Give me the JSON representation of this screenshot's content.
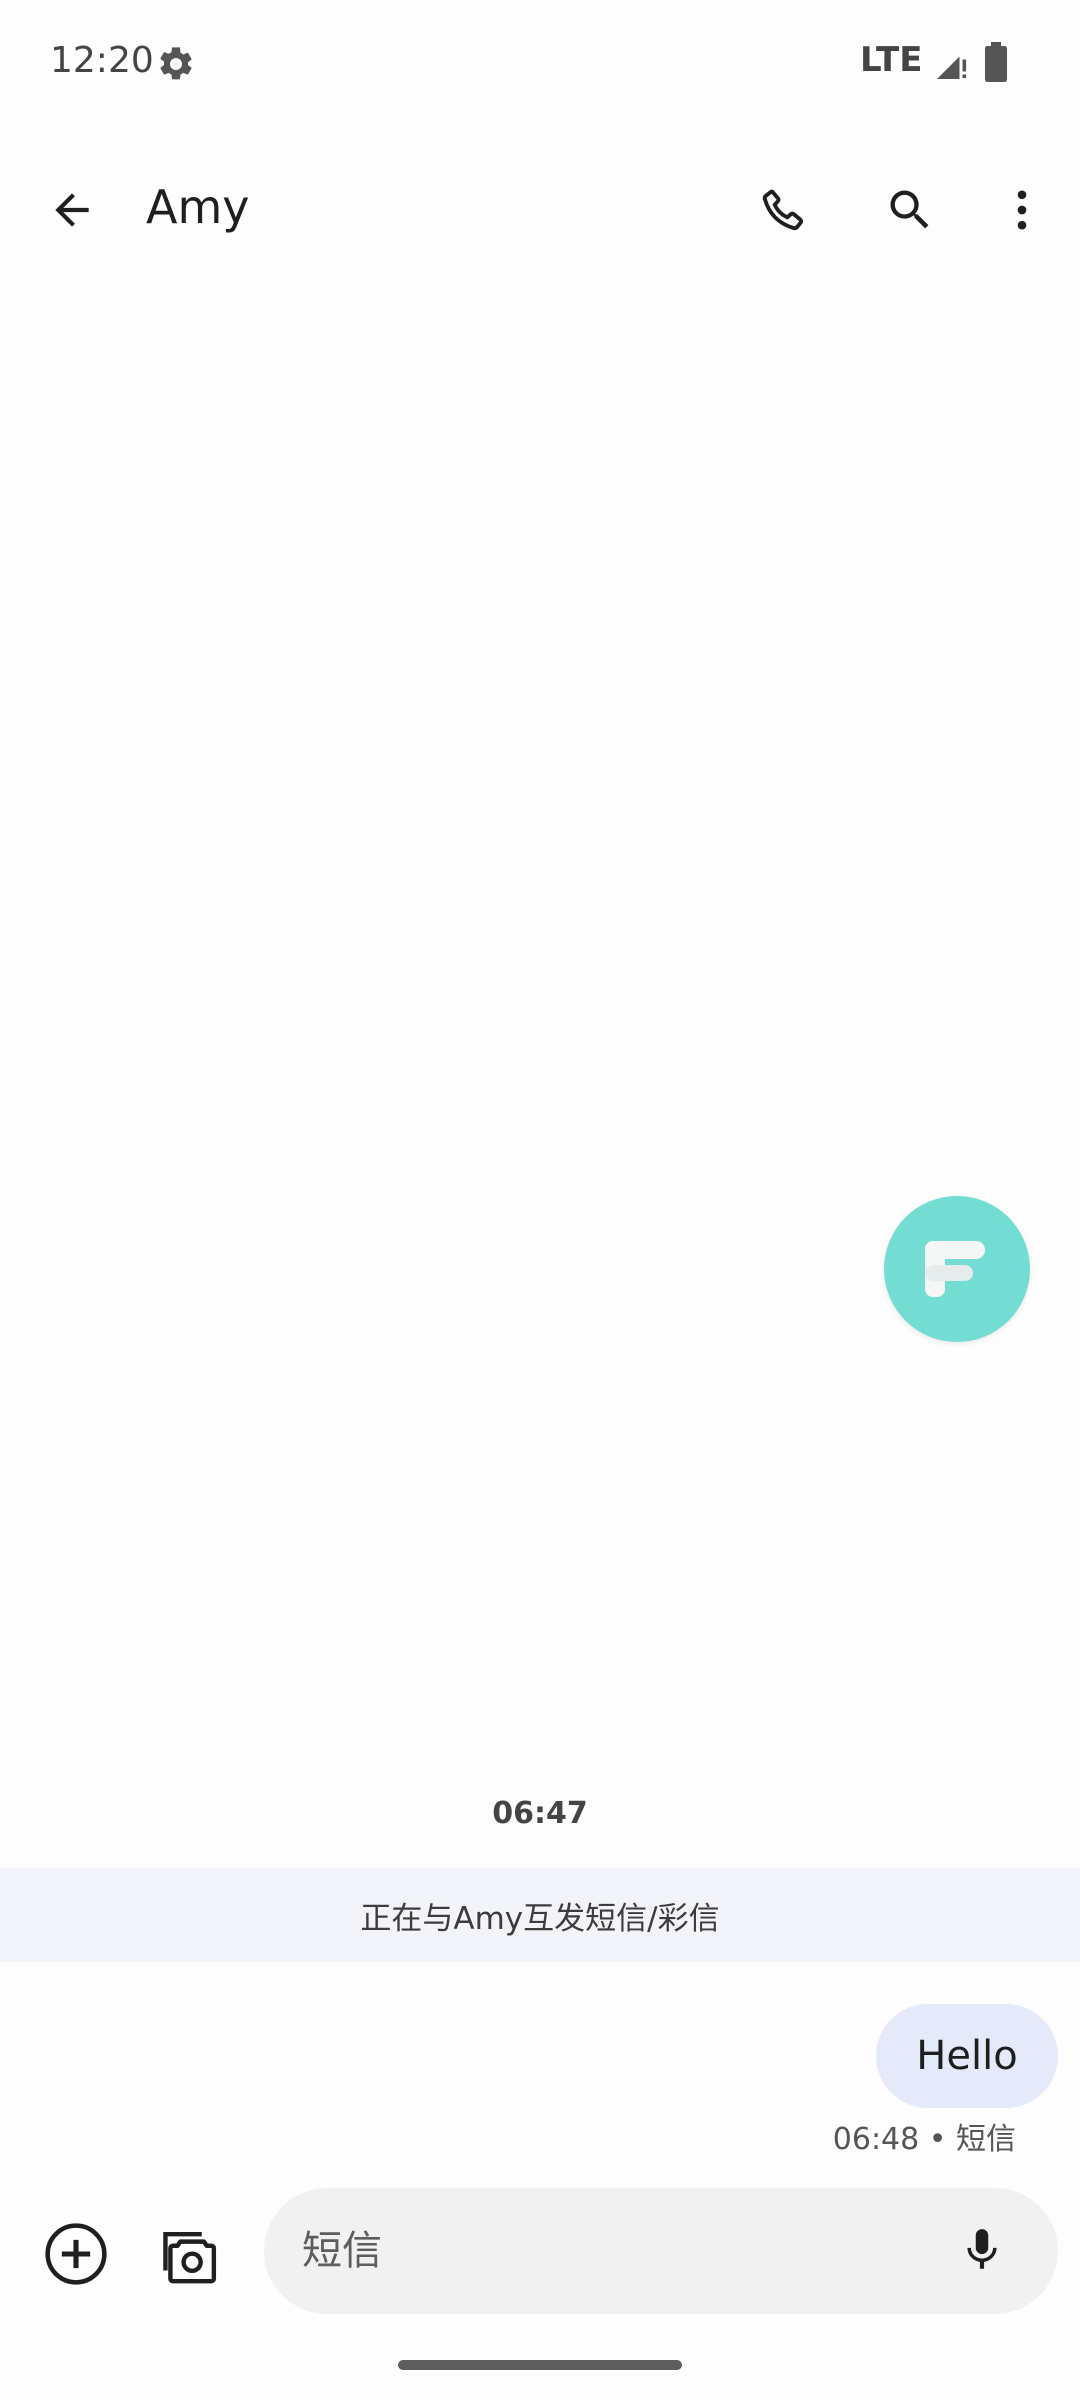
{
  "status_bar": {
    "time": "12:20",
    "network": "LTE",
    "icons": [
      "settings-gear-icon",
      "signal-icon",
      "battery-icon"
    ]
  },
  "app_bar": {
    "contact_name": "Amy",
    "icons": [
      "back-arrow-icon",
      "phone-icon",
      "search-icon",
      "more-vert-icon"
    ]
  },
  "floating_bubble": {
    "icon": "f-logo-icon",
    "color": "#74ddd3"
  },
  "conversation": {
    "date_stamp": "06:47",
    "banner": "正在与Amy互发短信/彩信",
    "messages": [
      {
        "direction": "outgoing",
        "text": "Hello",
        "meta": "06:48 • 短信"
      }
    ]
  },
  "compose": {
    "placeholder": "短信",
    "value": "",
    "icons": [
      "add-circle-icon",
      "gallery-camera-icon",
      "mic-icon"
    ]
  },
  "colors": {
    "bubble_out": "#e4eafa",
    "banner_bg": "#f2f4f9",
    "compose_bg": "#f1f1f1",
    "accent_teal": "#74ddd3"
  }
}
